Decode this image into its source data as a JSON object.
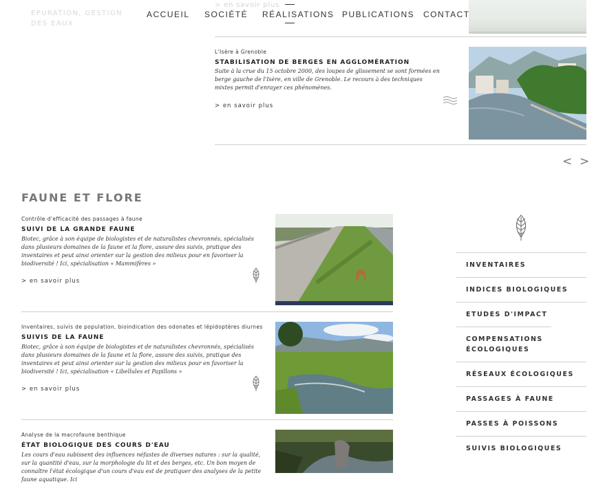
{
  "top_fragment": {
    "faded_category": "EPURATION, GESTION DES EAUX",
    "faded_link": "> en savoir plus"
  },
  "nav": {
    "items": [
      "ACCUEIL",
      "SOCIÉTÉ",
      "RÉALISATIONS",
      "PUBLICATIONS",
      "CONTACT"
    ],
    "active": "RÉALISATIONS"
  },
  "realisation": {
    "location": "L'Isère à Grenoble",
    "title": "STABILISATION DE BERGES EN AGGLOMÉRATION",
    "description": "Suite à la crue du 15 octobre 2000, des loupes de glissement se sont formées en berge gauche de l'Isère, en ville de Grenoble. Le recours à des techniques mixtes permit d'enrayer ces phénomènes.",
    "more": "> en savoir plus"
  },
  "pager": {
    "prev": "<",
    "next": ">"
  },
  "section": {
    "title": "FAUNE ET FLORE"
  },
  "articles": [
    {
      "category": "Contrôle d'efficacité des passages à faune",
      "title": "SUIVI DE LA GRANDE FAUNE",
      "description": "Biotec, grâce à son équipe de biologistes et de naturalistes chevronnés, spécialisés dans plusieurs domaines de la faune et la flore, assure des suivis, pratique des inventaires et peut ainsi orienter sur la gestion des milieux pour en favoriser la biodiversité ! Ici, spécialisation « Mammifères »",
      "more": "> en savoir plus"
    },
    {
      "category": "Inventaires, suivis de population, bioindication des odonates et lépidoptères diurnes",
      "title": "SUIVIS DE LA FAUNE",
      "description": "Biotec, grâce à son équipe de biologistes et de naturalistes chevronnés, spécialisés dans plusieurs domaines de la faune et la flore, assure des suivis, pratique des inventaires et peut ainsi orienter sur la gestion des milieux pour en favoriser la biodiversité ! Ici, spécialisation « Libellules et Papillons »",
      "more": "> en savoir plus"
    },
    {
      "category": "Analyse de la macrofaune benthique",
      "title": "ÉTAT BIOLOGIQUE DES COURS D'EAU",
      "description": "Les cours d'eau subissent des influences néfastes de diverses natures : sur la qualité, sur la quantité d'eau, sur la morphologie du lit et des berges, etc. Un bon moyen de connaître l'état écologique d'un cours d'eau est de pratiquer des analyses de la petite faune aquatique. Ici"
    }
  ],
  "sidebar": {
    "items": [
      "INVENTAIRES",
      "INDICES BIOLOGIQUES",
      "ETUDES D'IMPACT",
      "COMPENSATIONS ÉCOLOGIQUES",
      "RÉSEAUX ÉCOLOGIQUES",
      "PASSAGES À FAUNE",
      "PASSES À POISSONS",
      "SUIVIS BIOLOGIQUES"
    ]
  }
}
